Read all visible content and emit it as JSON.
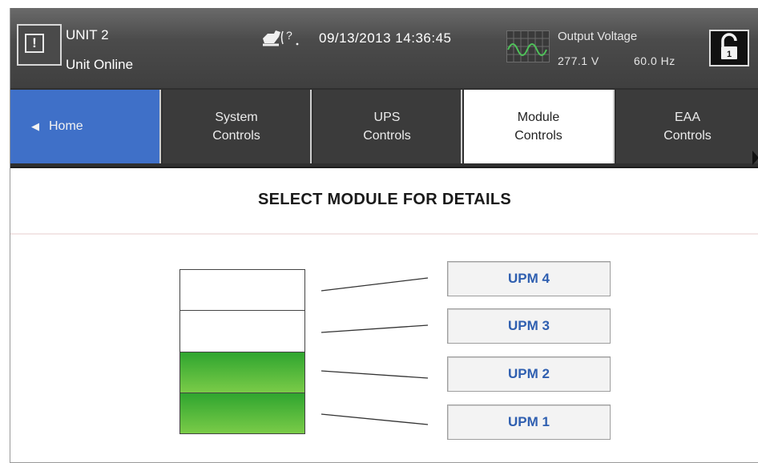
{
  "header": {
    "unit_name": "UNIT 2",
    "unit_status": "Unit Online",
    "alarm_glyph": "!",
    "help_glyph": "?",
    "datetime": "09/13/2013  14:36:45",
    "output_voltage_label": "Output Voltage",
    "output_voltage_value": "277.1 V",
    "output_frequency": "60.0 Hz",
    "lock_glyph": "1",
    "icons": [
      "alarm-icon",
      "help-icon",
      "waveform-icon",
      "unlocked-padlock-icon"
    ]
  },
  "nav": {
    "home_label": "Home",
    "tabs": [
      {
        "line1": "System",
        "line2": "Controls"
      },
      {
        "line1": "UPS",
        "line2": "Controls"
      },
      {
        "line1": "Module",
        "line2": "Controls"
      },
      {
        "line1": "EAA",
        "line2": "Controls"
      }
    ],
    "active_tab": "Module Controls"
  },
  "main": {
    "title": "SELECT MODULE FOR DETAILS",
    "modules": [
      {
        "label": "UPM 4",
        "online": false
      },
      {
        "label": "UPM 3",
        "online": false
      },
      {
        "label": "UPM 2",
        "online": true
      },
      {
        "label": "UPM 1",
        "online": true
      }
    ]
  },
  "colors": {
    "home_tab": "#3f70c8",
    "header_bg": "#4b4b4b",
    "module_online": "#3fae35",
    "upm_text": "#2f5fb0"
  }
}
